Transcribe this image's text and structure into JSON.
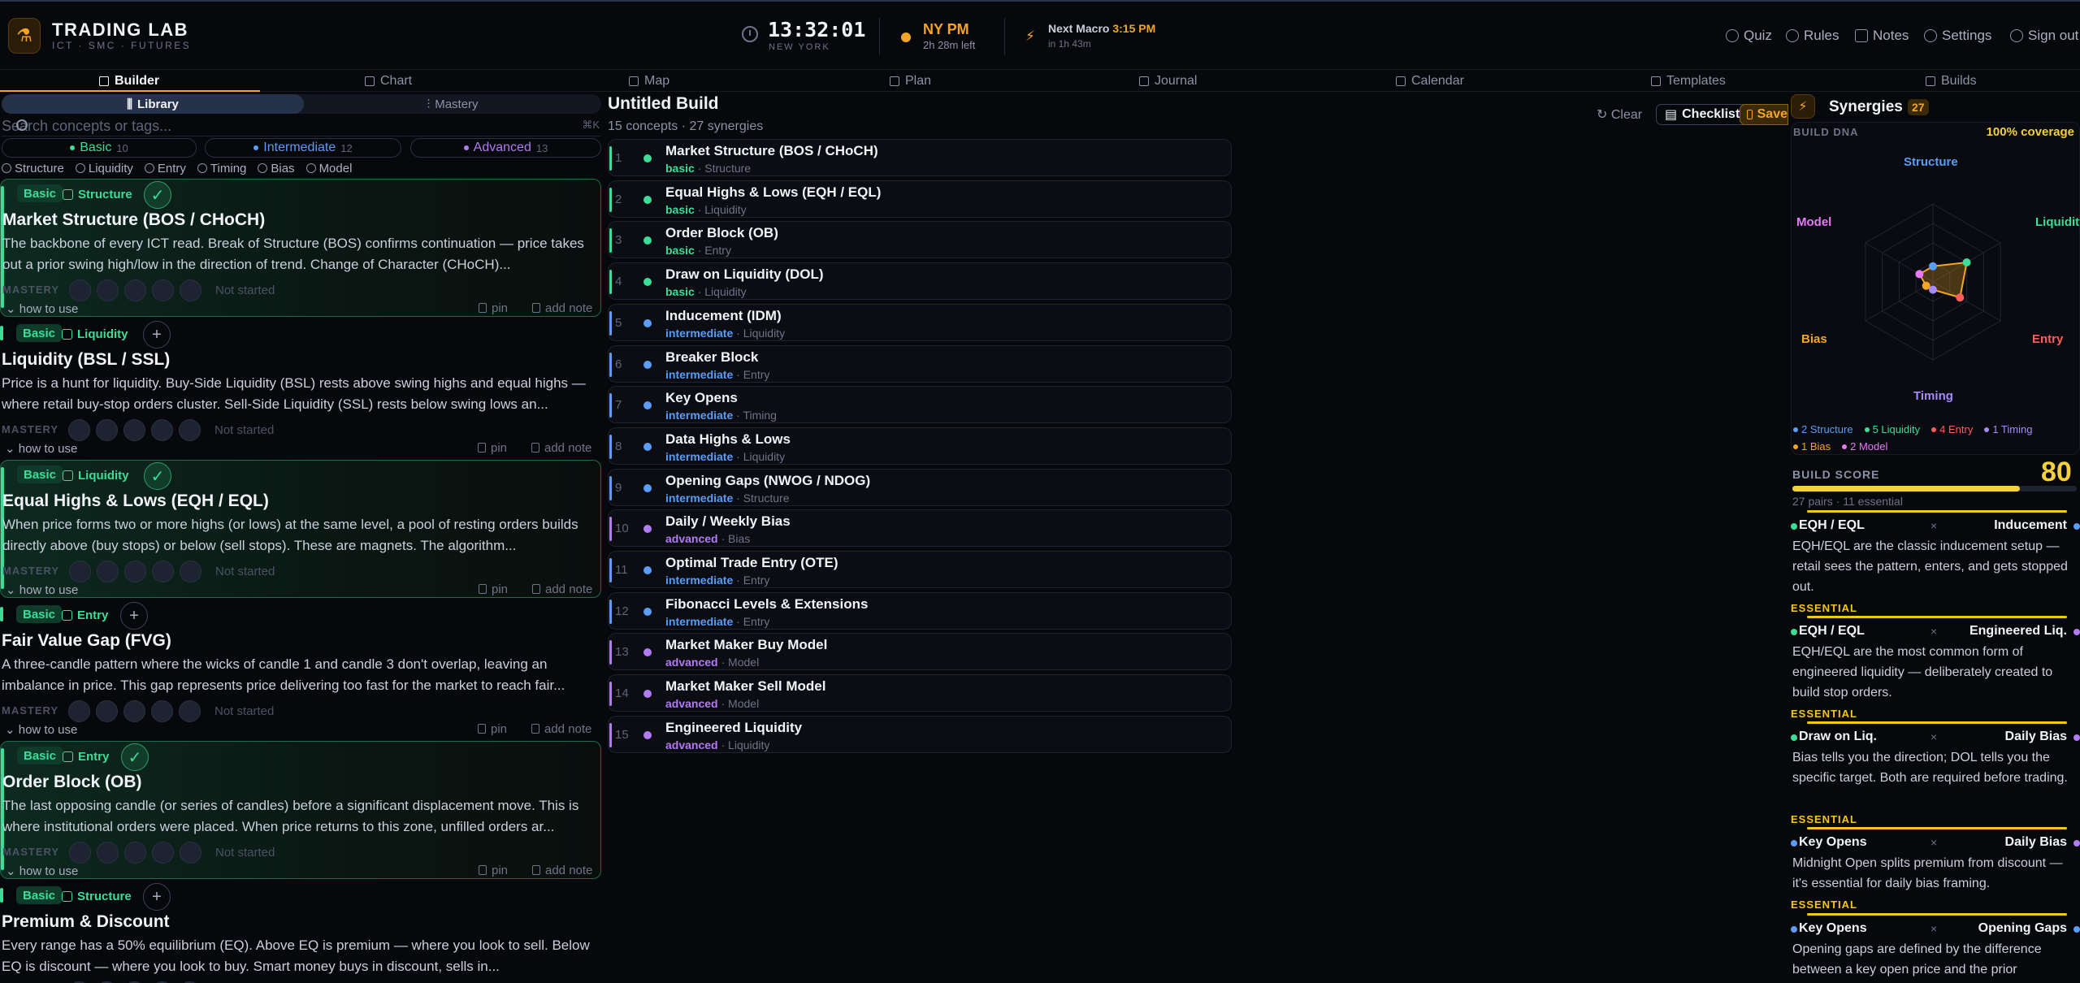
{
  "header": {
    "brand_title": "TRADING LAB",
    "brand_sub": "ICT · SMC · FUTURES",
    "time": "13:32:01",
    "city": "NEW YORK",
    "session": "NY PM",
    "session_left": "2h 28m left",
    "macro_label": "Next Macro",
    "macro_time": "3:15 PM",
    "macro_in": "in 1h 43m",
    "nav": [
      {
        "label": "Quiz",
        "icon": "quiz-icon"
      },
      {
        "label": "Rules",
        "icon": "shield-icon"
      },
      {
        "label": "Notes",
        "icon": "notes-icon"
      },
      {
        "label": "Settings",
        "icon": "gear-icon"
      },
      {
        "label": "Sign out",
        "icon": "sign-out-icon"
      }
    ]
  },
  "tabs": [
    "Builder",
    "Chart",
    "Map",
    "Plan",
    "Journal",
    "Calendar",
    "Templates",
    "Builds"
  ],
  "library": {
    "seg_library": "Library",
    "seg_mastery": "Mastery",
    "search_placeholder": "Search concepts or tags...",
    "search_kbd": "⌘K",
    "levels": [
      {
        "label": "Basic",
        "count": "10",
        "color": "#3ddc97"
      },
      {
        "label": "Intermediate",
        "count": "12",
        "color": "#5b9cf5"
      },
      {
        "label": "Advanced",
        "count": "13",
        "color": "#b07cf0"
      }
    ],
    "categories": [
      "Structure",
      "Liquidity",
      "Entry",
      "Timing",
      "Bias",
      "Model"
    ],
    "mastery_label": "MASTERY",
    "mastery_state": "Not started",
    "how_to": "how to use",
    "pin": "pin",
    "add_note": "add note",
    "cards": [
      {
        "level": "Basic",
        "category": "Structure",
        "added": true,
        "btn": "✓",
        "title": "Market Structure (BOS / CHoCH)",
        "desc": "The backbone of every ICT read. Break of Structure (BOS) confirms continuation — price takes out a prior swing high/low in the direction of trend. Change of Character (CHoCH)..."
      },
      {
        "level": "Basic",
        "category": "Liquidity",
        "added": false,
        "btn": "+",
        "title": "Liquidity (BSL / SSL)",
        "desc": "Price is a hunt for liquidity. Buy-Side Liquidity (BSL) rests above swing highs and equal highs — where retail buy-stop orders cluster. Sell-Side Liquidity (SSL) rests below swing lows an..."
      },
      {
        "level": "Basic",
        "category": "Liquidity",
        "added": true,
        "btn": "✓",
        "title": "Equal Highs & Lows (EQH / EQL)",
        "desc": "When price forms two or more highs (or lows) at the same level, a pool of resting orders builds directly above (buy stops) or below (sell stops). These are magnets. The algorithm..."
      },
      {
        "level": "Basic",
        "category": "Entry",
        "added": false,
        "btn": "+",
        "title": "Fair Value Gap (FVG)",
        "desc": "A three-candle pattern where the wicks of candle 1 and candle 3 don't overlap, leaving an imbalance in price. This gap represents price delivering too fast for the market to reach fair..."
      },
      {
        "level": "Basic",
        "category": "Entry",
        "added": true,
        "btn": "✓",
        "title": "Order Block (OB)",
        "desc": "The last opposing candle (or series of candles) before a significant displacement move. This is where institutional orders were placed. When price returns to this zone, unfilled orders ar..."
      },
      {
        "level": "Basic",
        "category": "Structure",
        "added": false,
        "btn": "+",
        "title": "Premium & Discount",
        "desc": "Every range has a 50% equilibrium (EQ). Above EQ is premium — where you look to sell. Below EQ is discount — where you look to buy. Smart money buys in discount, sells in..."
      }
    ]
  },
  "build": {
    "title": "Untitled Build",
    "sub": "15 concepts · 27 synergies",
    "clear": "Clear",
    "checklist": "Checklist",
    "save": "Save",
    "items": [
      {
        "num": "1",
        "name": "Market Structure (BOS / CHoCH)",
        "level": "basic",
        "category": "Structure",
        "color": "#3ddc97"
      },
      {
        "num": "2",
        "name": "Equal Highs & Lows (EQH / EQL)",
        "level": "basic",
        "category": "Liquidity",
        "color": "#3ddc97"
      },
      {
        "num": "3",
        "name": "Order Block (OB)",
        "level": "basic",
        "category": "Entry",
        "color": "#3ddc97"
      },
      {
        "num": "4",
        "name": "Draw on Liquidity (DOL)",
        "level": "basic",
        "category": "Liquidity",
        "color": "#3ddc97"
      },
      {
        "num": "5",
        "name": "Inducement (IDM)",
        "level": "intermediate",
        "category": "Liquidity",
        "color": "#5b9cf5"
      },
      {
        "num": "6",
        "name": "Breaker Block",
        "level": "intermediate",
        "category": "Entry",
        "color": "#5b9cf5"
      },
      {
        "num": "7",
        "name": "Key Opens",
        "level": "intermediate",
        "category": "Timing",
        "color": "#5b9cf5"
      },
      {
        "num": "8",
        "name": "Data Highs & Lows",
        "level": "intermediate",
        "category": "Liquidity",
        "color": "#5b9cf5"
      },
      {
        "num": "9",
        "name": "Opening Gaps (NWOG / NDOG)",
        "level": "intermediate",
        "category": "Structure",
        "color": "#5b9cf5"
      },
      {
        "num": "10",
        "name": "Daily / Weekly Bias",
        "level": "advanced",
        "category": "Bias",
        "color": "#b07cf0"
      },
      {
        "num": "11",
        "name": "Optimal Trade Entry (OTE)",
        "level": "intermediate",
        "category": "Entry",
        "color": "#5b9cf5"
      },
      {
        "num": "12",
        "name": "Fibonacci Levels & Extensions",
        "level": "intermediate",
        "category": "Entry",
        "color": "#5b9cf5"
      },
      {
        "num": "13",
        "name": "Market Maker Buy Model",
        "level": "advanced",
        "category": "Model",
        "color": "#b07cf0"
      },
      {
        "num": "14",
        "name": "Market Maker Sell Model",
        "level": "advanced",
        "category": "Model",
        "color": "#b07cf0"
      },
      {
        "num": "15",
        "name": "Engineered Liquidity",
        "level": "advanced",
        "category": "Liquidity",
        "color": "#b07cf0"
      }
    ]
  },
  "synergies": {
    "title": "Synergies",
    "count": "27",
    "dna_label": "BUILD DNA",
    "coverage": "100% coverage",
    "axes": [
      {
        "label": "Structure",
        "color": "#5b9cf5",
        "value": 2
      },
      {
        "label": "Liquidity",
        "color": "#3ddc97",
        "value": 5
      },
      {
        "label": "Entry",
        "color": "#ff5c5c",
        "value": 4
      },
      {
        "label": "Timing",
        "color": "#a78bfa",
        "value": 1
      },
      {
        "label": "Bias",
        "color": "#f5a524",
        "value": 1
      },
      {
        "label": "Model",
        "color": "#e879f9",
        "value": 2
      }
    ],
    "legend": [
      "2 Structure",
      "5 Liquidity",
      "4 Entry",
      "1 Timing",
      "1 Bias",
      "2 Model"
    ],
    "score_label": "BUILD SCORE",
    "score": "80",
    "score_fraction": 0.8,
    "score_sub": "27 pairs · 11 essential",
    "essential": "ESSENTIAL",
    "pairs": [
      {
        "a": "EQH / EQL",
        "a_color": "#3ddc97",
        "b": "Inducement",
        "b_color": "#5b9cf5",
        "text": "EQH/EQL are the classic inducement setup — retail sees the pattern, enters, and gets stopped out."
      },
      {
        "a": "EQH / EQL",
        "a_color": "#3ddc97",
        "b": "Engineered Liq.",
        "b_color": "#b07cf0",
        "text": "EQH/EQL are the most common form of engineered liquidity — deliberately created to build stop orders."
      },
      {
        "a": "Draw on Liq.",
        "a_color": "#3ddc97",
        "b": "Daily Bias",
        "b_color": "#b07cf0",
        "text": "Bias tells you the direction; DOL tells you the specific target. Both are required before trading."
      },
      {
        "a": "Key Opens",
        "a_color": "#5b9cf5",
        "b": "Daily Bias",
        "b_color": "#b07cf0",
        "text": "Midnight Open splits premium from discount — it's essential for daily bias framing."
      },
      {
        "a": "Key Opens",
        "a_color": "#5b9cf5",
        "b": "Opening Gaps",
        "b_color": "#5b9cf5",
        "text": "Opening gaps are defined by the difference between a key open price and the prior"
      }
    ]
  }
}
